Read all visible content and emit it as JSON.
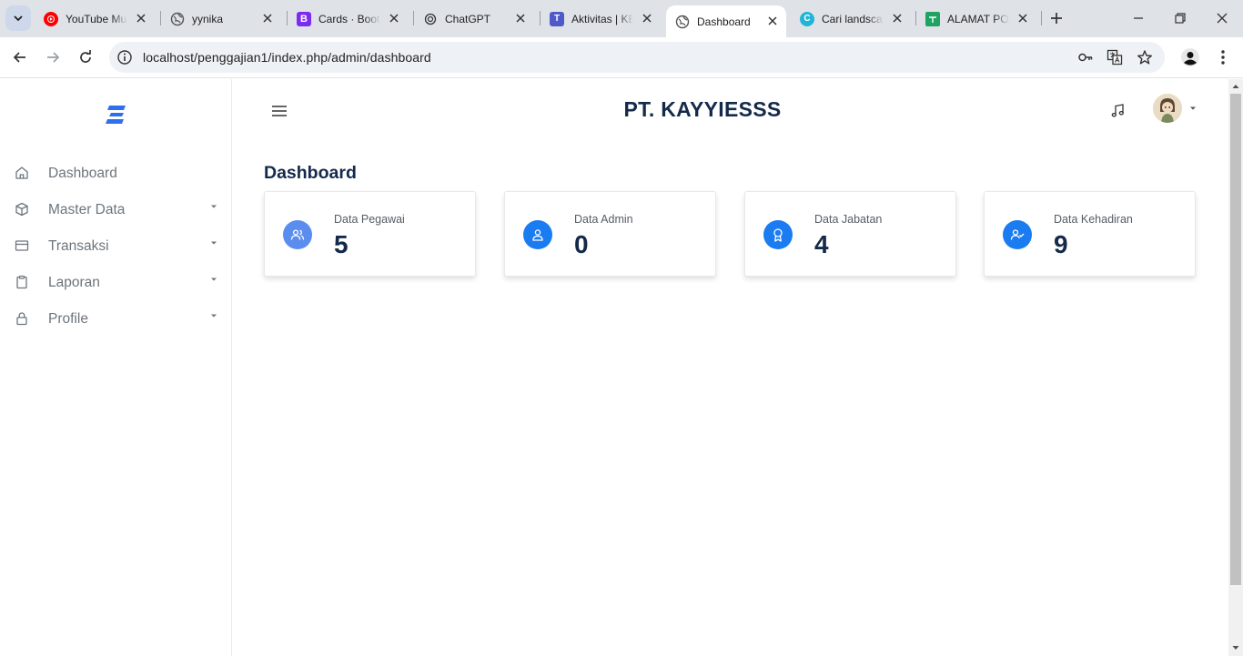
{
  "browser": {
    "tabs": [
      {
        "title": "YouTube Music",
        "favicon": "youtube-music-icon",
        "active": false
      },
      {
        "title": "yynika",
        "favicon": "globe-icon",
        "active": false
      },
      {
        "title": "Cards · Bootstrap",
        "favicon": "bootstrap-icon",
        "active": false
      },
      {
        "title": "ChatGPT",
        "favicon": "chatgpt-icon",
        "active": false
      },
      {
        "title": "Aktivitas | KB",
        "favicon": "teams-icon",
        "active": false
      },
      {
        "title": "Dashboard",
        "favicon": "globe-icon",
        "active": true
      },
      {
        "title": "Cari landscape",
        "favicon": "canva-icon",
        "active": false
      },
      {
        "title": "ALAMAT POS",
        "favicon": "sheets-icon",
        "active": false
      }
    ],
    "url": "localhost/penggajian1/index.php/admin/dashboard"
  },
  "sidebar": {
    "items": [
      {
        "label": "Dashboard",
        "icon": "home-icon",
        "has_caret": false
      },
      {
        "label": "Master Data",
        "icon": "box-icon",
        "has_caret": true
      },
      {
        "label": "Transaksi",
        "icon": "card-icon",
        "has_caret": true
      },
      {
        "label": "Laporan",
        "icon": "clipboard-icon",
        "has_caret": true
      },
      {
        "label": "Profile",
        "icon": "lock-icon",
        "has_caret": true
      }
    ]
  },
  "header": {
    "brand": "PT. KAYYIESSS"
  },
  "main": {
    "title": "Dashboard",
    "cards": [
      {
        "label": "Data Pegawai",
        "value": "5",
        "icon": "users-icon",
        "color": "#5b8def"
      },
      {
        "label": "Data Admin",
        "value": "0",
        "icon": "user-icon",
        "color": "#1a7cf0"
      },
      {
        "label": "Data Jabatan",
        "value": "4",
        "icon": "award-icon",
        "color": "#1a7cf0"
      },
      {
        "label": "Data Kehadiran",
        "value": "9",
        "icon": "user-check-icon",
        "color": "#1a7cf0"
      }
    ]
  },
  "colors": {
    "accent": "#1a7cf0",
    "heading": "#142a4a",
    "muted": "#6c757d"
  }
}
